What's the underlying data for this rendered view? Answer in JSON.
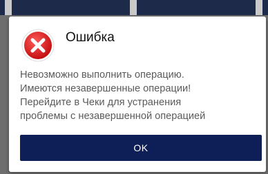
{
  "dialog": {
    "title": "Ошибка",
    "message_lines": [
      "Невозможно выполнить операцию.",
      "Имеются незавершенные операции!",
      "Перейдите в Чеки для устранения",
      "проблемы с незавершенной операцией"
    ],
    "ok_label": "OK",
    "icon": "error-icon"
  },
  "colors": {
    "button_bg": "#0e1f57",
    "icon_red": "#e02020",
    "top_bar": "#1d2a4a"
  }
}
